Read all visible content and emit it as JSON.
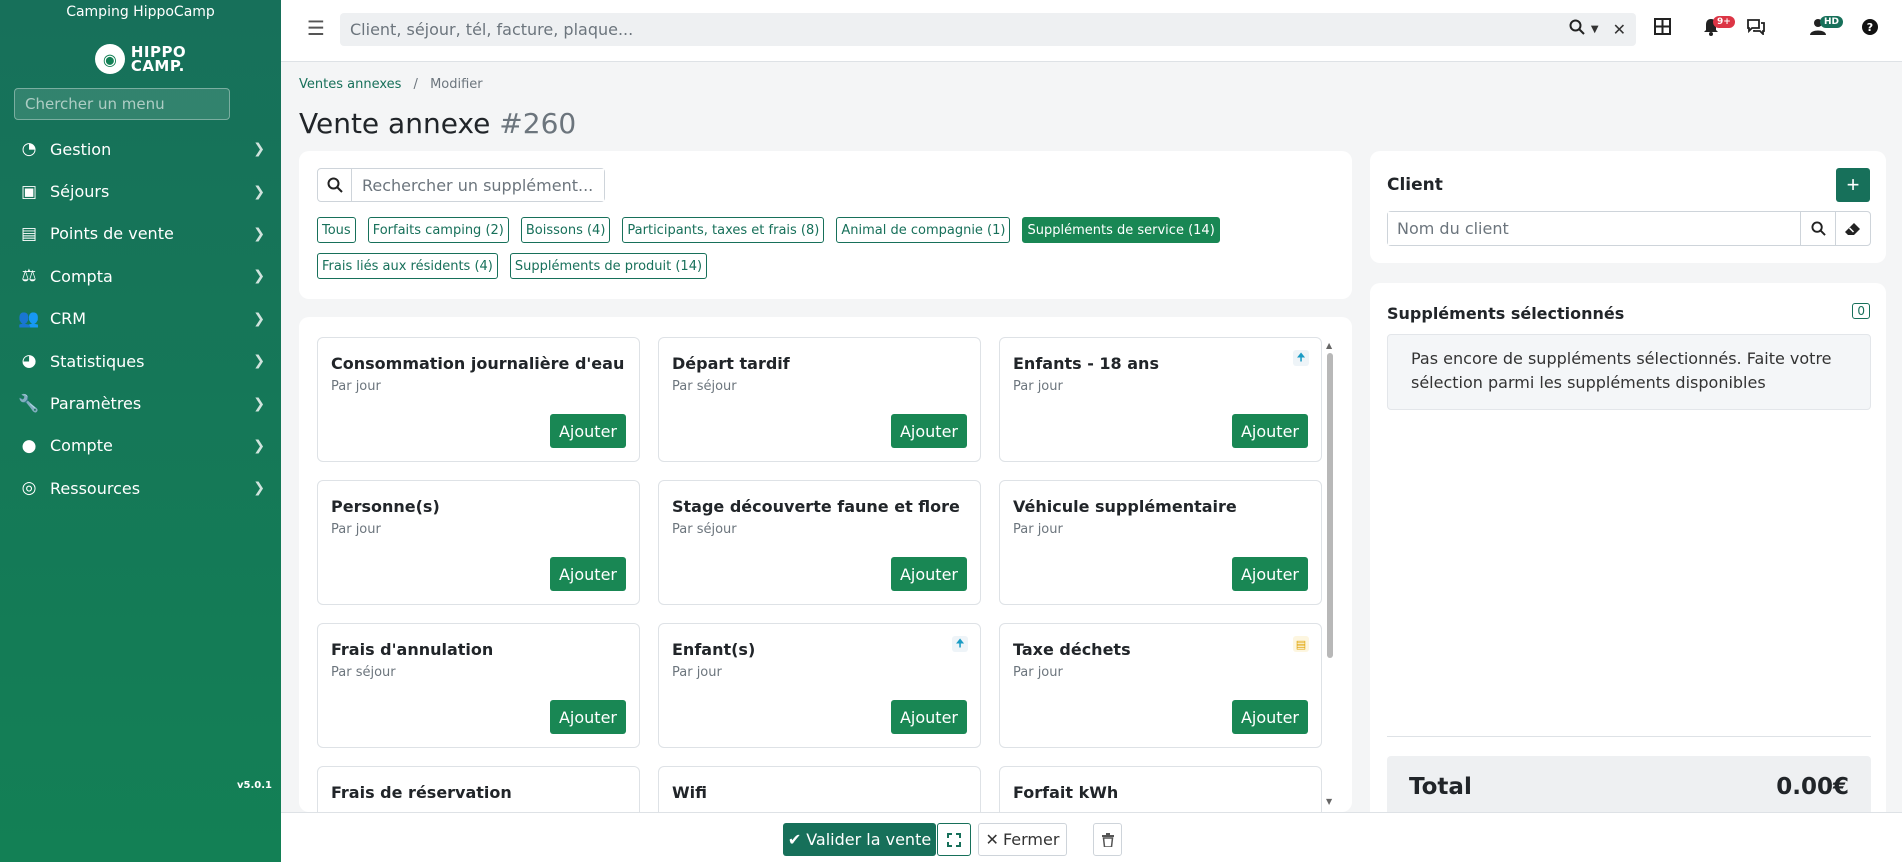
{
  "sidebar": {
    "camp_name": "Camping HippoCamp",
    "logo_line1": "HIPPO",
    "logo_line2": "CAMP.",
    "menu_search_placeholder": "Chercher un menu",
    "items": [
      {
        "label": "Gestion",
        "icon": "gauge-icon",
        "glyph": "◔"
      },
      {
        "label": "Séjours",
        "icon": "bag-icon",
        "glyph": "▣"
      },
      {
        "label": "Points de vente",
        "icon": "store-icon",
        "glyph": "▤"
      },
      {
        "label": "Compta",
        "icon": "scale-icon",
        "glyph": "⚖"
      },
      {
        "label": "CRM",
        "icon": "users-icon",
        "glyph": "👥"
      },
      {
        "label": "Statistiques",
        "icon": "pie-chart-icon",
        "glyph": "◕"
      },
      {
        "label": "Paramètres",
        "icon": "wrench-icon",
        "glyph": "🔧"
      },
      {
        "label": "Compte",
        "icon": "user-circle-icon",
        "glyph": "●"
      },
      {
        "label": "Ressources",
        "icon": "lifebuoy-icon",
        "glyph": "◎"
      }
    ],
    "version": "v5.0.1"
  },
  "topbar": {
    "search_placeholder": "Client, séjour, tél, facture, plaque...",
    "notifications_badge": "9+",
    "user_initials": "HD"
  },
  "breadcrumb": {
    "parent": "Ventes annexes",
    "separator": "/",
    "current": "Modifier"
  },
  "page": {
    "title": "Vente annexe",
    "number": "#260"
  },
  "filters": {
    "search_placeholder": "Rechercher un supplément...",
    "chips": [
      {
        "label": "Tous",
        "active": false
      },
      {
        "label": "Forfaits camping (2)",
        "active": false
      },
      {
        "label": "Boissons (4)",
        "active": false
      },
      {
        "label": "Participants, taxes et frais (8)",
        "active": false
      },
      {
        "label": "Animal de compagnie (1)",
        "active": false
      },
      {
        "label": "Suppléments de service (14)",
        "active": true
      },
      {
        "label": "Frais liés aux résidents (4)",
        "active": false
      },
      {
        "label": "Suppléments de produit (14)",
        "active": false
      }
    ]
  },
  "products": {
    "add_label": "Ajouter",
    "items": [
      {
        "name": "Consommation journalière d'eau",
        "unit": "Par jour",
        "marker": ""
      },
      {
        "name": "Départ tardif",
        "unit": "Par séjour",
        "marker": ""
      },
      {
        "name": "Enfants - 18 ans",
        "unit": "Par jour",
        "marker": "person"
      },
      {
        "name": "Personne(s)",
        "unit": "Par jour",
        "marker": ""
      },
      {
        "name": "Stage découverte faune et flore",
        "unit": "Par séjour",
        "marker": ""
      },
      {
        "name": "Véhicule supplémentaire",
        "unit": "Par jour",
        "marker": ""
      },
      {
        "name": "Frais d'annulation",
        "unit": "Par séjour",
        "marker": ""
      },
      {
        "name": "Enfant(s)",
        "unit": "Par jour",
        "marker": "person"
      },
      {
        "name": "Taxe déchets",
        "unit": "Par jour",
        "marker": "waste"
      },
      {
        "name": "Frais de réservation",
        "unit": "",
        "marker": ""
      },
      {
        "name": "Wifi",
        "unit": "",
        "marker": ""
      },
      {
        "name": "Forfait kWh",
        "unit": "",
        "marker": ""
      }
    ]
  },
  "client": {
    "title": "Client",
    "input_placeholder": "Nom du client"
  },
  "selected": {
    "title": "Suppléments sélectionnés",
    "count": "0",
    "empty_message": "Pas encore de suppléments sélectionnés. Faite votre sélection parmi les suppléments disponibles"
  },
  "total": {
    "label": "Total",
    "value": "0.00€"
  },
  "bottombar": {
    "validate_label": "Valider la vente",
    "close_label": "Fermer"
  },
  "colors": {
    "brand": "#17705a",
    "success": "#198754",
    "badge_red": "#dc3545"
  }
}
